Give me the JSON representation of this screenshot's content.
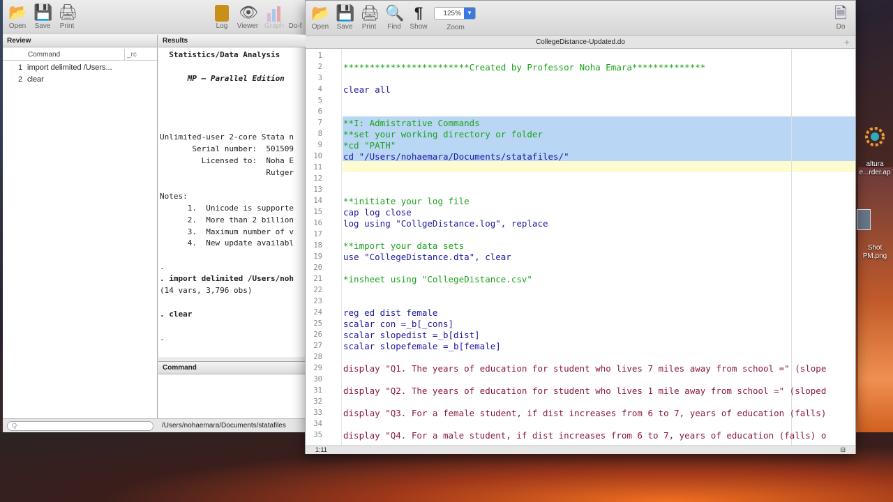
{
  "stata": {
    "toolbar": [
      {
        "label": "Open",
        "icon": "folder-open-icon"
      },
      {
        "label": "Save",
        "icon": "floppy-icon"
      },
      {
        "label": "Print",
        "icon": "printer-icon"
      },
      {
        "label": "Log",
        "icon": "log-book-icon"
      },
      {
        "label": "Viewer",
        "icon": "eye-icon"
      },
      {
        "label": "Graph",
        "icon": "bar-chart-icon"
      },
      {
        "label": "Do-f",
        "icon": "do-file-icon"
      }
    ],
    "review": {
      "title": "Review",
      "col_command": "Command",
      "col_rc": "_rc",
      "items": [
        {
          "num": "1",
          "text": "import delimited /Users..."
        },
        {
          "num": "2",
          "text": "clear"
        }
      ]
    },
    "results": {
      "title": "Results",
      "lines": [
        "  Statistics/Data Analysis",
        "",
        "      MP – Parallel Edition",
        "",
        "",
        "",
        "",
        "Unlimited-user 2-core Stata n",
        "       Serial number:  501509",
        "         Licensed to:  Noha E",
        "                       Rutger",
        "",
        "Notes:",
        "      1.  Unicode is supporte",
        "      2.  More than 2 billion",
        "      3.  Maximum number of v",
        "      4.  New update availabl",
        "",
        ".",
        ". import delimited /Users/noh",
        "(14 vars, 3,796 obs)",
        "",
        ". clear",
        "",
        "."
      ]
    },
    "command": {
      "title": "Command"
    },
    "status": {
      "search_placeholder": "Q·",
      "path": "/Users/nohaemara/Documents/statafiles"
    }
  },
  "editor": {
    "toolbar": [
      {
        "label": "Open",
        "icon": "folder-open-icon"
      },
      {
        "label": "Save",
        "icon": "floppy-icon"
      },
      {
        "label": "Print",
        "icon": "printer-icon"
      },
      {
        "label": "Find",
        "icon": "find-icon"
      },
      {
        "label": "Show",
        "icon": "pilcrow-icon"
      },
      {
        "label": "Zoom",
        "icon": "zoom-select"
      },
      {
        "label": "Do",
        "icon": "do-run-icon"
      }
    ],
    "zoom_value": "125%",
    "title": "CollegeDistance-Updated.do",
    "cursor_pos": "1:11",
    "lines": [
      {
        "n": "1",
        "t": "",
        "c": ""
      },
      {
        "n": "2",
        "t": "************************Created by Professor Noha Emara**************",
        "c": "c"
      },
      {
        "n": "3",
        "t": "",
        "c": ""
      },
      {
        "n": "4",
        "t": "clear all",
        "c": "k"
      },
      {
        "n": "5",
        "t": "",
        "c": ""
      },
      {
        "n": "6",
        "t": "",
        "c": ""
      },
      {
        "n": "7",
        "t": "**I: Admistrative Commands",
        "c": "c"
      },
      {
        "n": "8",
        "t": "**set your working directory or folder",
        "c": "c"
      },
      {
        "n": "9",
        "t": "*cd \"PATH\"",
        "c": "c"
      },
      {
        "n": "10",
        "t": "cd \"/Users/nohaemara/Documents/statafiles/\"",
        "c": "k"
      },
      {
        "n": "11",
        "t": "",
        "c": ""
      },
      {
        "n": "12",
        "t": "",
        "c": ""
      },
      {
        "n": "13",
        "t": "",
        "c": ""
      },
      {
        "n": "14",
        "t": "**initiate your log file",
        "c": "c"
      },
      {
        "n": "15",
        "t": "cap log close",
        "c": "k"
      },
      {
        "n": "16",
        "t": "log using \"CollgeDistance.log\", replace",
        "c": "k"
      },
      {
        "n": "17",
        "t": "",
        "c": ""
      },
      {
        "n": "18",
        "t": "**import your data sets",
        "c": "c"
      },
      {
        "n": "19",
        "t": "use \"CollegeDistance.dta\", clear",
        "c": "k"
      },
      {
        "n": "20",
        "t": "",
        "c": ""
      },
      {
        "n": "21",
        "t": "*insheet using \"CollegeDistance.csv\"",
        "c": "c"
      },
      {
        "n": "22",
        "t": "",
        "c": ""
      },
      {
        "n": "23",
        "t": "",
        "c": ""
      },
      {
        "n": "24",
        "t": "reg ed dist female",
        "c": "k"
      },
      {
        "n": "25",
        "t": "scalar con =_b[_cons]",
        "c": "k"
      },
      {
        "n": "26",
        "t": "scalar slopedist =_b[dist]",
        "c": "k"
      },
      {
        "n": "27",
        "t": "scalar slopefemale =_b[female]",
        "c": "k"
      },
      {
        "n": "28",
        "t": "",
        "c": ""
      },
      {
        "n": "29",
        "t": "display \"Q1. The years of education for student who lives 7 miles away from school =\" (slope",
        "c": "s"
      },
      {
        "n": "30",
        "t": "",
        "c": ""
      },
      {
        "n": "31",
        "t": "display \"Q2. The years of education for student who lives 1 mile away from school =\" (sloped",
        "c": "s"
      },
      {
        "n": "32",
        "t": "",
        "c": ""
      },
      {
        "n": "33",
        "t": "display \"Q3. For a female student, if dist increases from 6 to 7, years of education (falls)",
        "c": "s"
      },
      {
        "n": "34",
        "t": "",
        "c": ""
      },
      {
        "n": "35",
        "t": "display \"Q4. For a male student, if dist increases from 6 to 7, years of education (falls) o",
        "c": "s"
      }
    ]
  },
  "desktop": {
    "icons": [
      {
        "label": "altura\ne...rder.ap"
      },
      {
        "label": "Shot\nPM.png"
      }
    ]
  }
}
